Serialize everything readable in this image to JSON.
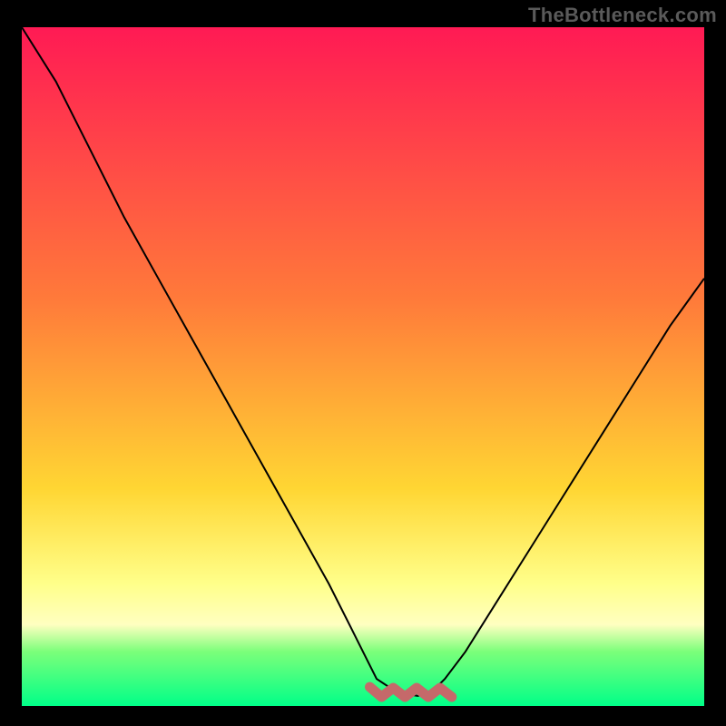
{
  "watermark": "TheBottleneck.com",
  "colors": {
    "page_bg": "#000000",
    "curve": "#000000",
    "annotation": "#c5696a",
    "grad_top": "#ff1a54",
    "grad_mid1": "#ff7a3a",
    "grad_mid2": "#ffd633",
    "grad_low": "#ffff8a",
    "grad_green1": "#7bff7a",
    "grad_green2": "#00ff88"
  },
  "chart_data": {
    "type": "line",
    "title": "",
    "xlabel": "",
    "ylabel": "",
    "xlim": [
      0,
      100
    ],
    "ylim": [
      0,
      100
    ],
    "series": [
      {
        "name": "bottleneck-curve",
        "x": [
          0,
          5,
          10,
          15,
          20,
          25,
          30,
          35,
          40,
          45,
          48,
          50,
          52,
          55,
          58,
          60,
          62,
          65,
          70,
          75,
          80,
          85,
          90,
          95,
          100
        ],
        "y": [
          100,
          92,
          82,
          72,
          63,
          54,
          45,
          36,
          27,
          18,
          12,
          8,
          4,
          2,
          1.5,
          2,
          4,
          8,
          16,
          24,
          32,
          40,
          48,
          56,
          63
        ]
      }
    ],
    "annotation": {
      "name": "optimal-range-marker",
      "x_start": 51,
      "x_end": 63,
      "y": 2
    },
    "gradient_stops_pct": [
      0,
      40,
      68,
      82,
      88,
      92,
      100
    ]
  }
}
